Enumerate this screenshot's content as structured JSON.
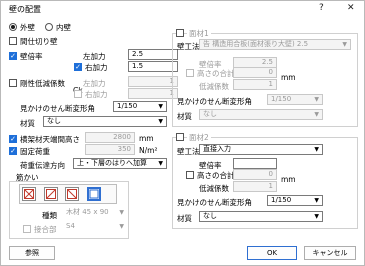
{
  "window": {
    "title": "壁の配置",
    "help": "?",
    "close": "✕"
  },
  "left": {
    "wall_type": {
      "outer": "外壁",
      "inner": "内壁"
    },
    "partition_wall": "間仕切り壁",
    "wall_ratio": {
      "label": "壁倍率",
      "left_label": "左加力",
      "left_value": "2.5",
      "right_label": "右加力",
      "right_value": "1.5"
    },
    "reduction": {
      "label": "剛性低減係数",
      "sub": "Ck",
      "left_label": "左加力",
      "left_value": "1",
      "right_label": "右加力",
      "right_value": "1"
    },
    "shear_angle": {
      "label": "見かけのせん断変形角",
      "value": "1/150"
    },
    "material": {
      "label": "材質",
      "value": "なし"
    },
    "horizontal": {
      "label": "横架材天端間高さ",
      "value": "2800",
      "unit": "mm"
    },
    "fixed_load": {
      "label": "固定荷重",
      "value": "350",
      "unit": "N/m²"
    },
    "load_direction": {
      "label": "荷重伝達方向",
      "value": "上・下層のはりへ加算"
    },
    "brace": {
      "label": "筋かい",
      "type_label": "種類",
      "type_value": "木材 45 x 90",
      "joint_label": "接合部",
      "joint_value": "S4"
    }
  },
  "panel1": {
    "title": "面材1",
    "method_label": "壁工法",
    "method_value": "告 構造用合板(面材張り大壁) 2.5",
    "wall_ratio_label": "壁倍率",
    "wall_ratio_value": "2.5",
    "height_total_label": "高さの合計",
    "height_total_value": "0",
    "unit": "mm",
    "reduction_label": "低減係数",
    "reduction_value": "1",
    "shear_label": "見かけのせん断変形角",
    "shear_value": "1/150",
    "material_label": "材質",
    "material_value": "なし"
  },
  "panel2": {
    "title": "面材2",
    "method_label": "壁工法",
    "method_value": "直接入力",
    "wall_ratio_label": "壁倍率",
    "wall_ratio_value": "",
    "height_total_label": "高さの合計",
    "height_total_value": "0",
    "unit": "mm",
    "reduction_label": "低減係数",
    "reduction_value": "1",
    "shear_label": "見かけのせん断変形角",
    "shear_value": "1/150",
    "material_label": "材質",
    "material_value": "なし"
  },
  "buttons": {
    "reference": "参照",
    "ok": "OK",
    "cancel": "キャンセル"
  }
}
